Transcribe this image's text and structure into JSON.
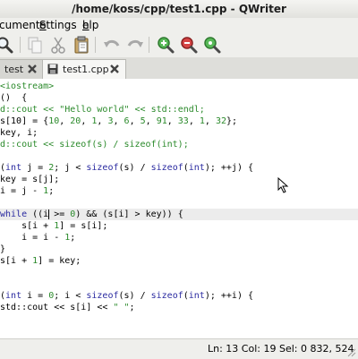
{
  "window": {
    "title": "/home/koss/cpp/test1.cpp - QWriter"
  },
  "menu": {
    "items": [
      {
        "prefix": "",
        "accel": "",
        "rest": "cument"
      },
      {
        "prefix": "",
        "accel": "S",
        "rest": "ettings"
      },
      {
        "prefix": "",
        "accel": "h",
        "rest": "elp"
      }
    ]
  },
  "toolbar": {
    "buttons": [
      {
        "icon": "find-icon"
      },
      {
        "icon": "copy-icon"
      },
      {
        "icon": "cut-icon"
      },
      {
        "icon": "paste-icon"
      },
      {
        "icon": "undo-icon"
      },
      {
        "icon": "redo-icon"
      },
      {
        "icon": "zoom-in-icon"
      },
      {
        "icon": "zoom-out-icon"
      },
      {
        "icon": "zoom-reset-icon"
      }
    ]
  },
  "tabs": [
    {
      "label": "test",
      "active": false
    },
    {
      "label": "test1.cpp",
      "active": true
    }
  ],
  "editor": {
    "lines": [
      [
        [
          "pp",
          "<iostream>"
        ]
      ],
      [
        [
          "",
          "()  {"
        ]
      ],
      [
        [
          "fn",
          "d::cout << "
        ],
        [
          "str",
          "\"Hello world\""
        ],
        [
          "fn",
          " << std::endl;"
        ]
      ],
      [
        [
          "",
          "s[10] = {"
        ],
        [
          "num",
          "10"
        ],
        [
          "",
          ", "
        ],
        [
          "num",
          "20"
        ],
        [
          "",
          ", "
        ],
        [
          "num",
          "1"
        ],
        [
          "",
          ", "
        ],
        [
          "num",
          "3"
        ],
        [
          "",
          ", "
        ],
        [
          "num",
          "6"
        ],
        [
          "",
          ", "
        ],
        [
          "num",
          "5"
        ],
        [
          "",
          ", "
        ],
        [
          "num",
          "91"
        ],
        [
          "",
          ", "
        ],
        [
          "num",
          "33"
        ],
        [
          "",
          ", "
        ],
        [
          "num",
          "1"
        ],
        [
          "",
          ", "
        ],
        [
          "num",
          "32"
        ],
        [
          "",
          "};"
        ]
      ],
      [
        [
          "",
          "key, i;"
        ]
      ],
      [
        [
          "fn",
          "d::cout << sizeof(s) / sizeof(int);"
        ]
      ],
      [
        [
          "",
          ""
        ]
      ],
      [
        [
          "",
          "("
        ],
        [
          "kw",
          "int"
        ],
        [
          "",
          " j = "
        ],
        [
          "num",
          "2"
        ],
        [
          "",
          "; j < "
        ],
        [
          "kw",
          "sizeof"
        ],
        [
          "",
          "(s) / "
        ],
        [
          "kw",
          "sizeof"
        ],
        [
          "",
          "("
        ],
        [
          "kw",
          "int"
        ],
        [
          "",
          "); ++j) {"
        ]
      ],
      [
        [
          "",
          "key = s[j];"
        ]
      ],
      [
        [
          "",
          "i = j - "
        ],
        [
          "num",
          "1"
        ],
        [
          "",
          ";"
        ]
      ],
      [
        [
          "",
          ""
        ]
      ],
      [
        [
          "kw",
          "while"
        ],
        [
          "",
          " ((i >= "
        ],
        [
          "num",
          "0"
        ],
        [
          "",
          ") && (s[i] > key)) {"
        ]
      ],
      [
        [
          "",
          "    s[i + "
        ],
        [
          "num",
          "1"
        ],
        [
          "",
          "] = s[i];"
        ]
      ],
      [
        [
          "",
          "    i = i - "
        ],
        [
          "num",
          "1"
        ],
        [
          "",
          ";"
        ]
      ],
      [
        [
          "",
          "}"
        ]
      ],
      [
        [
          "",
          "s[i + "
        ],
        [
          "num",
          "1"
        ],
        [
          "",
          "] = key;"
        ]
      ],
      [
        [
          "",
          ""
        ]
      ],
      [
        [
          "",
          ""
        ]
      ],
      [
        [
          "",
          "("
        ],
        [
          "kw",
          "int"
        ],
        [
          "",
          " i = "
        ],
        [
          "num",
          "0"
        ],
        [
          "",
          "; i < "
        ],
        [
          "kw",
          "sizeof"
        ],
        [
          "",
          "(s) / "
        ],
        [
          "kw",
          "sizeof"
        ],
        [
          "",
          "("
        ],
        [
          "kw",
          "int"
        ],
        [
          "",
          "); ++i) {"
        ]
      ],
      [
        [
          "",
          "std::cout << s[i] << "
        ],
        [
          "str",
          "\" \""
        ],
        [
          "",
          ";"
        ]
      ],
      [
        [
          "",
          ""
        ]
      ]
    ],
    "current_line_index": 11
  },
  "status": {
    "text": "Ln: 13 Col: 19 Sel: 0  832, 524"
  },
  "colors": {
    "keyword": "#2a2aa0",
    "string": "#2b8a2b",
    "current_line": "#ececec"
  }
}
